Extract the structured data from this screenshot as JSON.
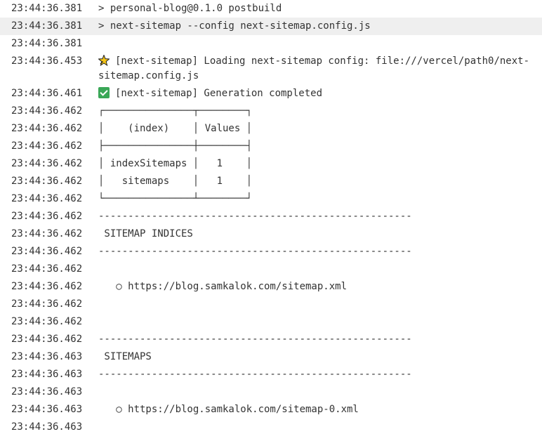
{
  "lines": [
    {
      "ts": "23:44:36.381",
      "text": "> personal-blog@0.1.0 postbuild"
    },
    {
      "ts": "23:44:36.381",
      "text": "> next-sitemap --config next-sitemap.config.js"
    },
    {
      "ts": "23:44:36.381",
      "text": ""
    },
    {
      "ts": "23:44:36.453",
      "icon": "sparkle-icon",
      "text": "[next-sitemap] Loading next-sitemap config: file:///vercel/path0/next-sitemap.config.js"
    },
    {
      "ts": "23:44:36.461",
      "icon": "check-mark-icon",
      "text": "[next-sitemap] Generation completed"
    },
    {
      "ts": "23:44:36.462",
      "text": "┌───────────────┬────────┐"
    },
    {
      "ts": "23:44:36.462",
      "text": "│    (index)    │ Values │"
    },
    {
      "ts": "23:44:36.462",
      "text": "├───────────────┼────────┤"
    },
    {
      "ts": "23:44:36.462",
      "text": "│ indexSitemaps │   1    │"
    },
    {
      "ts": "23:44:36.462",
      "text": "│   sitemaps    │   1    │"
    },
    {
      "ts": "23:44:36.462",
      "text": "└───────────────┴────────┘"
    },
    {
      "ts": "23:44:36.462",
      "text": "-----------------------------------------------------"
    },
    {
      "ts": "23:44:36.462",
      "text": " SITEMAP INDICES"
    },
    {
      "ts": "23:44:36.462",
      "text": "-----------------------------------------------------"
    },
    {
      "ts": "23:44:36.462",
      "text": ""
    },
    {
      "ts": "23:44:36.462",
      "text": "   ○ https://blog.samkalok.com/sitemap.xml"
    },
    {
      "ts": "23:44:36.462",
      "text": ""
    },
    {
      "ts": "23:44:36.462",
      "text": ""
    },
    {
      "ts": "23:44:36.462",
      "text": "-----------------------------------------------------"
    },
    {
      "ts": "23:44:36.463",
      "text": " SITEMAPS"
    },
    {
      "ts": "23:44:36.463",
      "text": "-----------------------------------------------------"
    },
    {
      "ts": "23:44:36.463",
      "text": ""
    },
    {
      "ts": "23:44:36.463",
      "text": "   ○ https://blog.samkalok.com/sitemap-0.xml"
    },
    {
      "ts": "23:44:36.463",
      "text": ""
    }
  ],
  "highlight_color": "#efefef",
  "check_color": "#3aa757"
}
